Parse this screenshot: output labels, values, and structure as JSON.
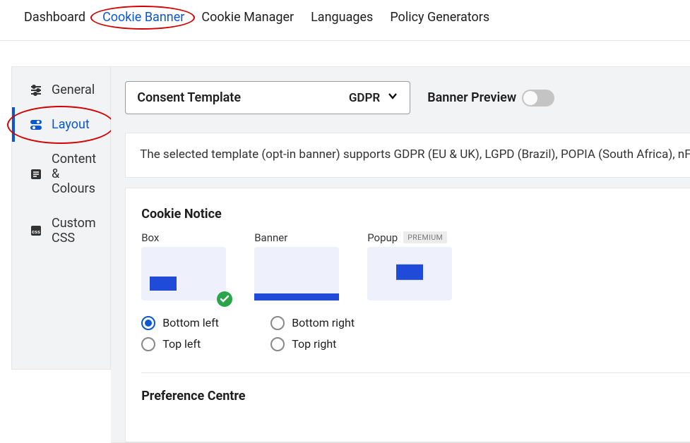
{
  "topnav": {
    "items": [
      "Dashboard",
      "Cookie Banner",
      "Cookie Manager",
      "Languages",
      "Policy Generators"
    ],
    "active_index": 1
  },
  "sidebar": {
    "items": [
      {
        "label": "General"
      },
      {
        "label": "Layout"
      },
      {
        "label": "Content & Colours"
      },
      {
        "label": "Custom CSS"
      }
    ],
    "active_index": 1
  },
  "template": {
    "label": "Consent Template",
    "value": "GDPR"
  },
  "banner_preview": {
    "label": "Banner Preview",
    "on": false
  },
  "description": "The selected template (opt-in banner) supports GDPR (EU & UK), LGPD (Brazil), POPIA (South Africa), nFADP (Switzerland), Privacy Act (Australia), PDPL (Saudi Arabia), PDPL (Argentina), PDPL (Andorra), DPA (Faroe Island)",
  "cookie_notice": {
    "heading": "Cookie Notice",
    "types": {
      "box": "Box",
      "banner": "Banner",
      "popup": "Popup",
      "premium_badge": "PREMIUM"
    },
    "selected_type": "box",
    "positions": {
      "bottom_left": "Bottom left",
      "bottom_right": "Bottom right",
      "top_left": "Top left",
      "top_right": "Top right"
    },
    "selected_position": "bottom_left"
  },
  "preference_centre": {
    "heading": "Preference Centre"
  }
}
